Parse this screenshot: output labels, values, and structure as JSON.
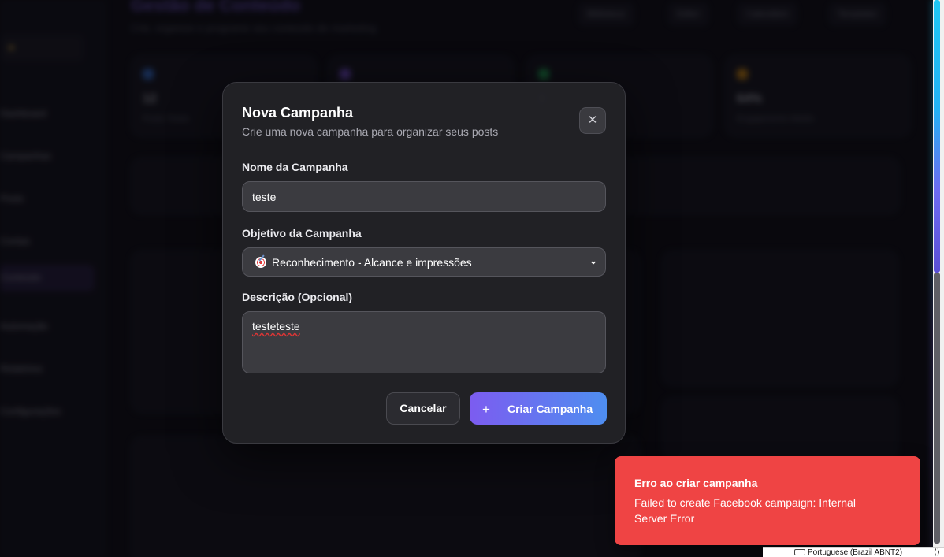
{
  "background": {
    "page_title": "Gestão de Conteúdo",
    "page_subtitle": "Crie, organize e programe seu conteúdo de marketing",
    "top_buttons": [
      "Biblioteca",
      "Editor",
      "Calendário",
      "Templates"
    ],
    "sidebar_items": [
      "Dashboard",
      "Campanhas",
      "Posts",
      "Contas",
      "Conteúdo",
      "Automação",
      "Relatórios",
      "Configurações"
    ],
    "stat_cards": [
      {
        "value": "12",
        "label": "Posts Totais",
        "color": "#3b82f6"
      },
      {
        "value": "",
        "label": "",
        "color": "#8b5cf6"
      },
      {
        "value": "3",
        "label": "",
        "color": "#22c55e"
      },
      {
        "value": "64%",
        "label": "Engajamento Médio",
        "color": "#f59e0b"
      }
    ]
  },
  "modal": {
    "title": "Nova Campanha",
    "description": "Crie uma nova campanha para organizar seus posts",
    "close_icon": "close-icon",
    "name_label": "Nome da Campanha",
    "name_value": "teste",
    "objective_label": "Objetivo da Campanha",
    "objective_value": "Reconhecimento - Alcance e impressões",
    "objective_icon": "target-icon",
    "description_label": "Descrição (Opcional)",
    "description_value": "testeteste",
    "cancel_label": "Cancelar",
    "create_label": "Criar Campanha"
  },
  "toast": {
    "title": "Erro ao criar campanha",
    "message": "Failed to create Facebook campaign: Internal Server Error",
    "color": "#ef4444"
  },
  "ime": {
    "label": "Portuguese (Brazil ABNT2)"
  }
}
